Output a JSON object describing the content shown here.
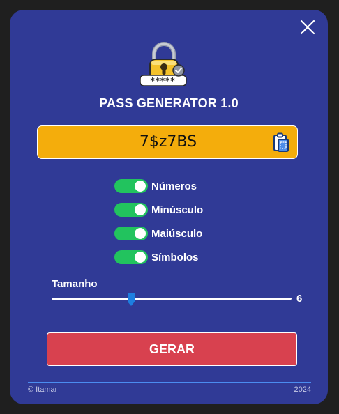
{
  "app": {
    "title": "PASS GENERATOR 1.0"
  },
  "password": {
    "value": "7$z7BS",
    "masked_badge": "*****"
  },
  "options": [
    {
      "label": "Números",
      "enabled": true
    },
    {
      "label": "Minúsculo",
      "enabled": true
    },
    {
      "label": "Maiúsculo",
      "enabled": true
    },
    {
      "label": "Símbolos",
      "enabled": true
    }
  ],
  "size": {
    "label": "Tamanho",
    "value": "6",
    "min": 1,
    "max": 32,
    "fraction": 0.33
  },
  "generate_button": {
    "label": "GERAR"
  },
  "footer": {
    "left": "© Itamar",
    "right": "2024"
  },
  "colors": {
    "background": "#303a96",
    "password_box": "#f4ad0c",
    "toggle_on": "#22c35e",
    "generate_button": "#d8414f",
    "slider_thumb": "#1d7fe0",
    "footer_line": "#4b8cf0"
  },
  "icons": {
    "close": "close-icon",
    "logo": "padlock-icon",
    "copy": "clipboard-icon",
    "check": "check-badge-icon"
  }
}
